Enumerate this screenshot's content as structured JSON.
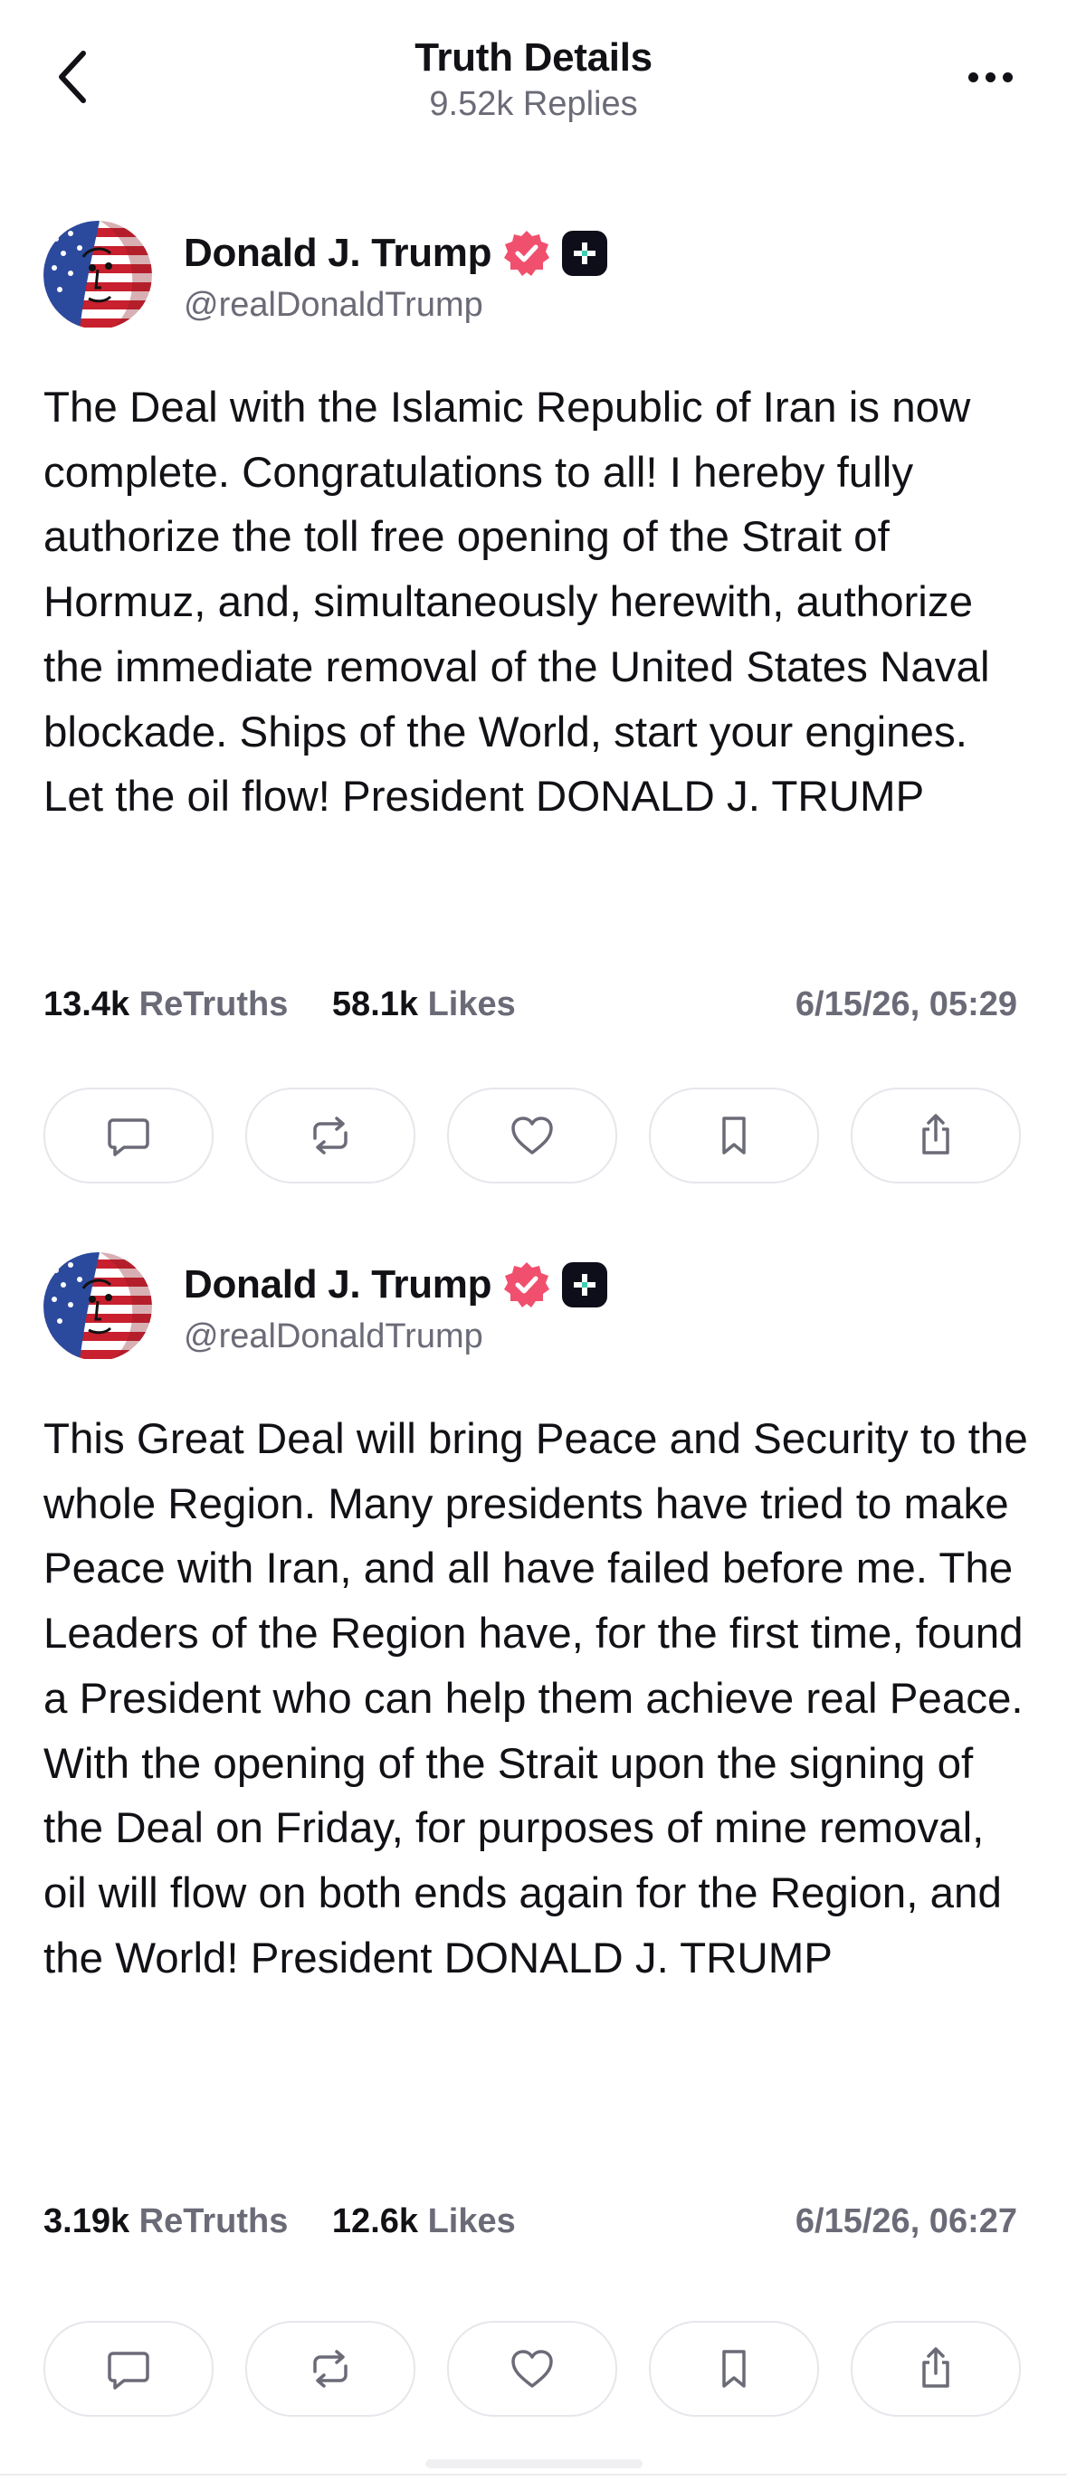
{
  "header": {
    "title": "Truth Details",
    "subtitle": "9.52k Replies",
    "back_icon": "chevron-left-icon",
    "more_icon": "ellipsis-horizontal-icon"
  },
  "posts": [
    {
      "author_name": "Donald J. Trump",
      "author_handle": "@realDonaldTrump",
      "text": "The Deal with the Islamic Republic of Iran is now complete. Congratulations to all! I hereby fully authorize the toll free opening of the Strait of Hormuz, and, simultaneously herewith, authorize the immediate removal of the United States Naval blockade. Ships of the World, start your engines. Let the oil flow! President DONALD J. TRUMP",
      "retruths_count": "13.4k",
      "retruths_label": "ReTruths",
      "likes_count": "58.1k",
      "likes_label": "Likes",
      "timestamp": "6/15/26, 05:29"
    },
    {
      "author_name": "Donald J. Trump",
      "author_handle": "@realDonaldTrump",
      "text": "This Great Deal will bring Peace and Security to the whole Region. Many presidents have tried to make Peace with Iran, and all have failed before me. The Leaders of the Region have, for the first time, found a President who can help them achieve real Peace. With the opening of the Strait upon the signing of the Deal on Friday, for purposes of mine removal, oil will flow on both ends again for the Region, and the World! President DONALD J. TRUMP",
      "retruths_count": "3.19k",
      "retruths_label": "ReTruths",
      "likes_count": "12.6k",
      "likes_label": "Likes",
      "timestamp": "6/15/26, 06:27"
    }
  ],
  "actions": [
    "reply-icon",
    "retruth-icon",
    "like-icon",
    "bookmark-icon",
    "share-icon"
  ],
  "colors": {
    "text_primary": "#111116",
    "text_secondary": "#6b6b78",
    "verified_badge": "#f0506e",
    "plus_badge": "#0e0e1a",
    "plus_accent": "#3ecfb2",
    "button_border": "#e6e6ec"
  }
}
